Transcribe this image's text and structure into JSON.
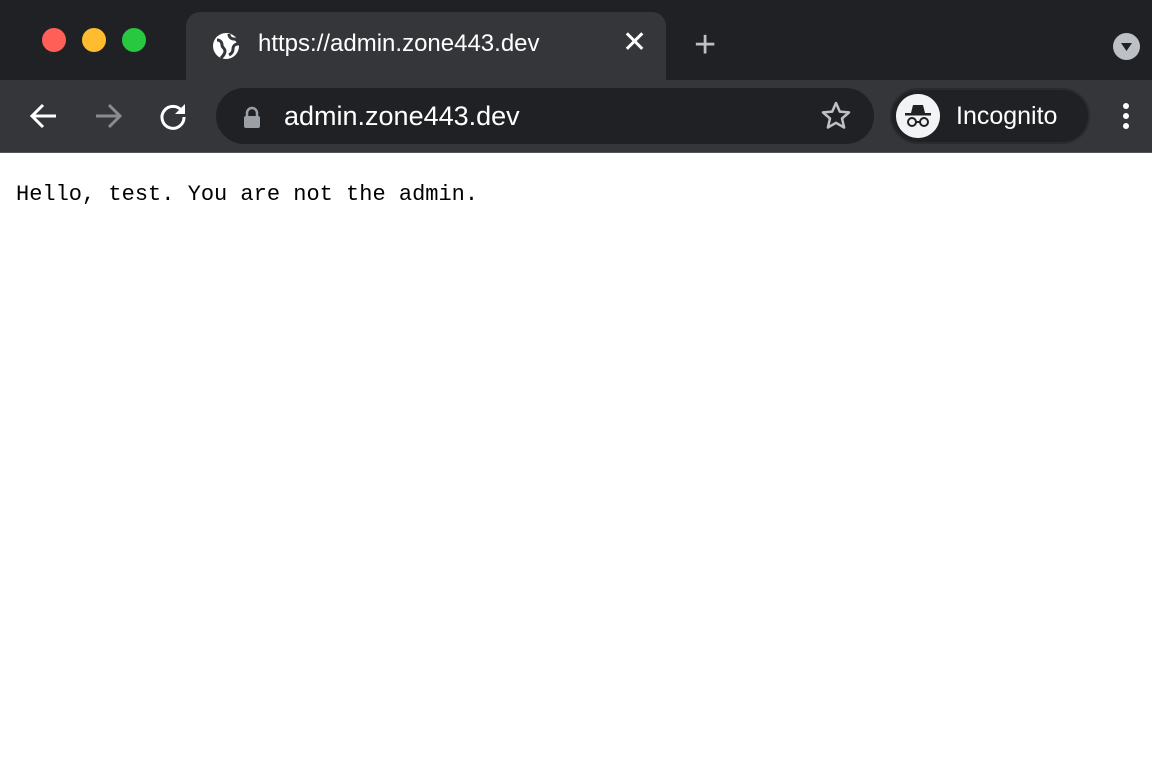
{
  "window": {
    "traffic_lights": {
      "close": "#ff5f57",
      "minimize": "#febc2e",
      "zoom": "#28c840"
    }
  },
  "tab": {
    "title": "https://admin.zone443.dev",
    "icon": "globe-icon"
  },
  "toolbar": {
    "url": "admin.zone443.dev",
    "profile_label": "Incognito"
  },
  "page": {
    "message": "Hello, test. You are not the admin."
  }
}
